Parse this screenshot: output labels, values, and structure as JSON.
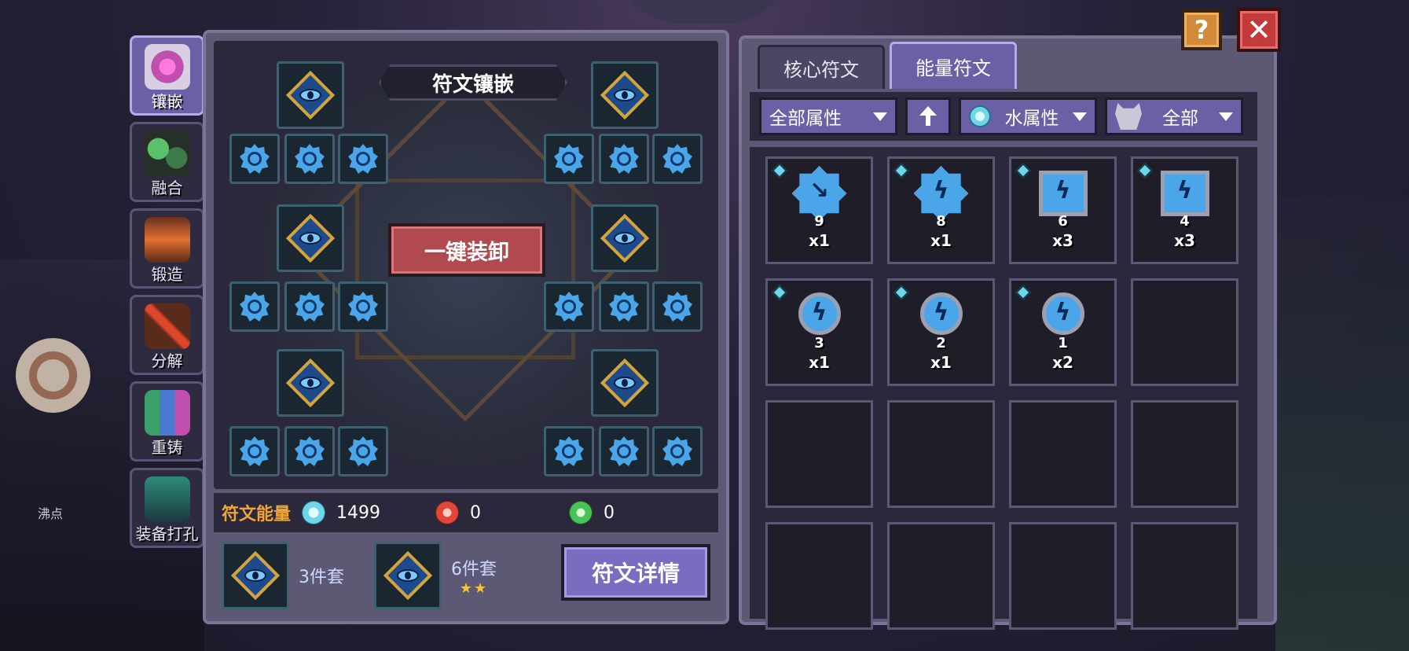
{
  "side_tabs": [
    {
      "label": "镶嵌",
      "icon": "inlay-icon",
      "active": true,
      "color": "#c04fb0"
    },
    {
      "label": "融合",
      "icon": "fusion-icon",
      "active": false,
      "color": "#3c7a4a"
    },
    {
      "label": "锻造",
      "icon": "forge-icon",
      "active": false,
      "color": "#a04030"
    },
    {
      "label": "分解",
      "icon": "decompose-icon",
      "active": false,
      "color": "#c0402a"
    },
    {
      "label": "重铸",
      "icon": "recast-icon",
      "active": false,
      "color": "#3a8a6a"
    },
    {
      "label": "装备打孔",
      "icon": "punch-icon",
      "active": false,
      "color": "#2f8a7a"
    }
  ],
  "left_panel": {
    "title": "符文镶嵌",
    "unequip_label": "一键装卸",
    "energy_title": "符文能量",
    "energies": [
      {
        "icon": "water-energy-icon",
        "value": "1499",
        "color": "#6fd6ea"
      },
      {
        "icon": "fire-energy-icon",
        "value": "0",
        "color": "#e0463a"
      },
      {
        "icon": "wind-energy-icon",
        "value": "0",
        "color": "#4ac25a"
      }
    ],
    "set1_label": "3件套",
    "set2_label": "6件套",
    "set2_stars": "★★",
    "detail_label": "符文详情"
  },
  "right_panel": {
    "tabs": [
      {
        "label": "核心符文",
        "active": false
      },
      {
        "label": "能量符文",
        "active": true
      }
    ],
    "filters": {
      "attribute_label": "全部属性",
      "element_label": "水属性",
      "monster_label": "全部"
    },
    "items": [
      {
        "shape": "star",
        "glyph": "↘",
        "level": "9",
        "qty": "x1"
      },
      {
        "shape": "star",
        "glyph": "ϟ",
        "level": "8",
        "qty": "x1"
      },
      {
        "shape": "frame",
        "glyph": "ϟ",
        "level": "6",
        "qty": "x3"
      },
      {
        "shape": "frame",
        "glyph": "ϟ",
        "level": "4",
        "qty": "x3"
      },
      {
        "shape": "circle",
        "glyph": "ϟ",
        "level": "3",
        "qty": "x1"
      },
      {
        "shape": "circle",
        "glyph": "ϟ",
        "level": "2",
        "qty": "x1"
      },
      {
        "shape": "circle",
        "glyph": "ϟ",
        "level": "1",
        "qty": "x2"
      }
    ],
    "empty_cells": 9
  },
  "buttons": {
    "help": "?",
    "close": "✕"
  },
  "hud": {
    "label": "沸点"
  }
}
